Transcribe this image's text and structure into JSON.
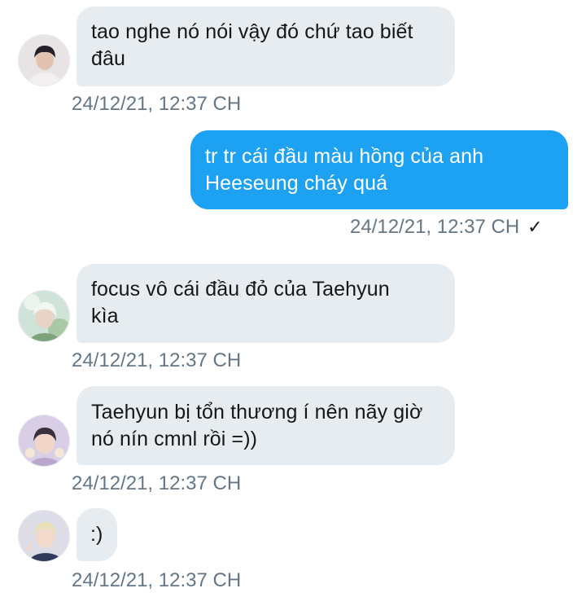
{
  "messages": [
    {
      "direction": "in",
      "lines": [
        "tao nghe nó nói vậy đó chứ tao biết",
        "đâu"
      ],
      "timestamp": "24/12/21, 12:37 CH"
    },
    {
      "direction": "out",
      "lines": [
        "tr tr cái đầu màu hồng của anh",
        "Heeseung cháy quá"
      ],
      "timestamp": "24/12/21, 12:37 CH",
      "seen_mark": "✓"
    },
    {
      "direction": "in",
      "lines": [
        "focus vô cái đầu đỏ của Taehyun",
        "kìa"
      ],
      "timestamp": "24/12/21, 12:37 CH"
    },
    {
      "direction": "in",
      "lines": [
        "Taehyun bị tổn thương í nên nãy giờ",
        "nó nín cmnl rồi =))"
      ],
      "timestamp": "24/12/21, 12:37 CH"
    },
    {
      "direction": "in",
      "lines": [
        ":)"
      ],
      "timestamp": "24/12/21, 12:37 CH"
    }
  ],
  "colors": {
    "incoming_bubble": "#e6ecf0",
    "outgoing_bubble": "#1da1f2",
    "timestamp_text": "#657786"
  },
  "icons": [
    "avatar",
    "checkmark-icon"
  ]
}
